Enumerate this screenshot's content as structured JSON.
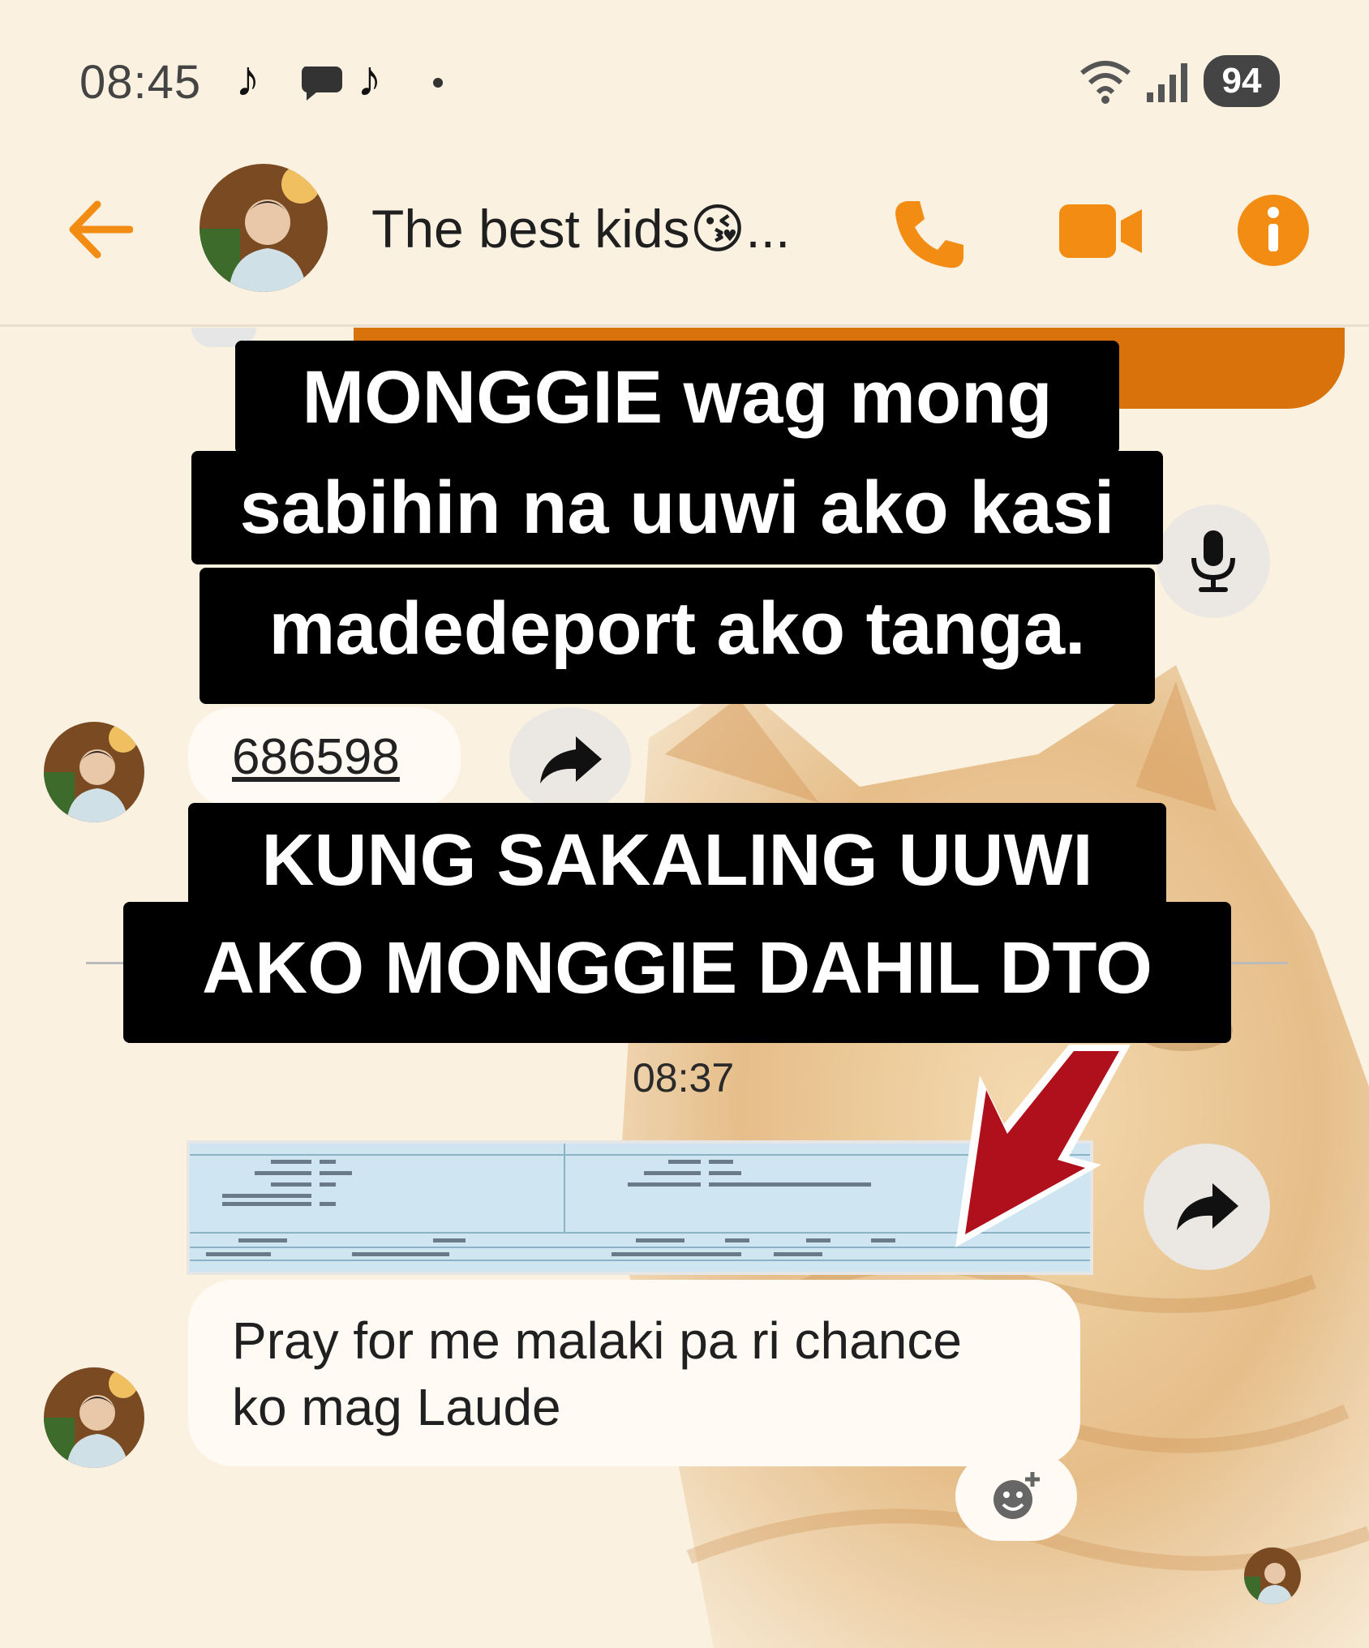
{
  "status_bar": {
    "time": "08:45",
    "battery": "94",
    "icons": [
      "tiktok-icon",
      "chat-bubble-icon",
      "tiktok-icon",
      "dot-icon",
      "wifi-icon",
      "signal-icon",
      "battery-icon"
    ]
  },
  "header": {
    "title": "The best kids😘...",
    "icons": [
      "back-arrow-icon",
      "phone-icon",
      "video-camera-icon",
      "info-icon"
    ]
  },
  "colors": {
    "accent": "#f28c13",
    "background": "#fbf1e1",
    "arrow": "#b0101c"
  },
  "captions": {
    "top": [
      "MONGGIE wag mong",
      "sabihin na uuwi ako kasi",
      "madedeport ako tanga."
    ],
    "middle": [
      "KUNG SAKALING UUWI",
      "AKO MONGGIE DAHIL DTO"
    ]
  },
  "messages": {
    "code": "686598",
    "timestamp": "08:37",
    "text_lines": [
      "Pray for me malaki pa ri  chance",
      "ko mag Laude"
    ]
  }
}
